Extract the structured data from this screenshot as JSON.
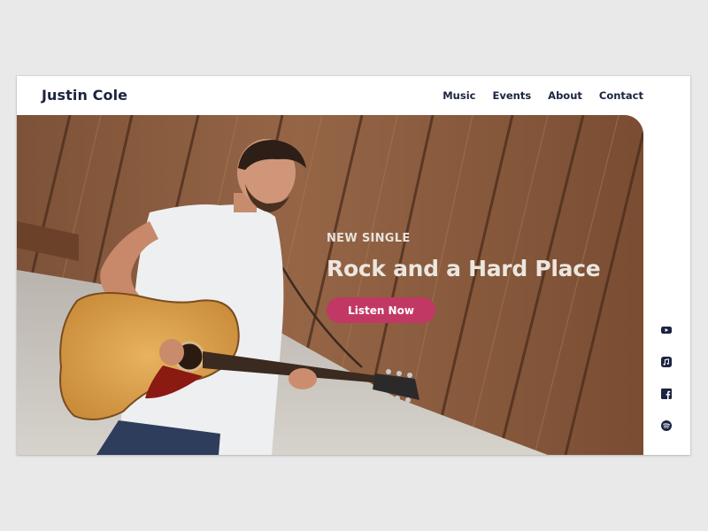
{
  "brand": {
    "name": "Justin Cole"
  },
  "nav": {
    "items": [
      "Music",
      "Events",
      "About",
      "Contact"
    ]
  },
  "hero": {
    "eyebrow": "NEW SINGLE",
    "headline": "Rock and a Hard Place",
    "cta_label": "Listen Now",
    "photo": "musician-with-acoustic-guitar-photo"
  },
  "social": {
    "icons": [
      "youtube-icon",
      "apple-music-icon",
      "facebook-icon",
      "spotify-icon"
    ]
  },
  "colors": {
    "accent": "#c23865",
    "navy": "#1c2440",
    "background": "#e9e9e9",
    "card": "#ffffff"
  }
}
